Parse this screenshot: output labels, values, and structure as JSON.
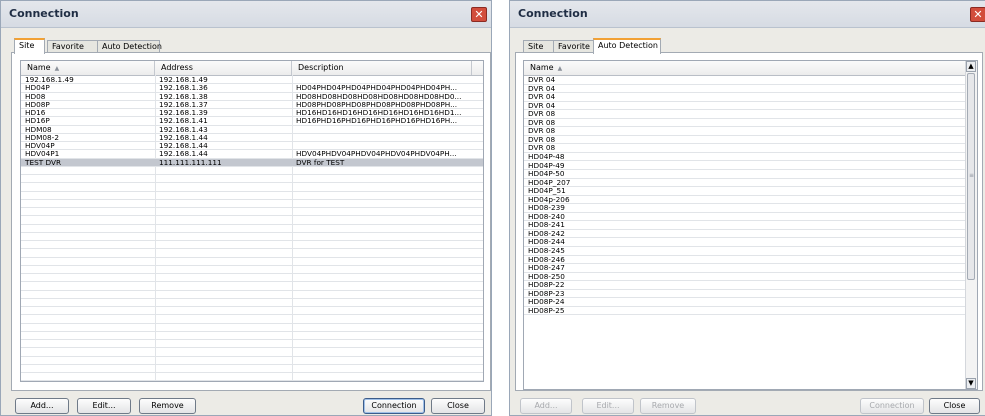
{
  "left": {
    "title": "Connection",
    "tabs": [
      {
        "label": "Site"
      },
      {
        "label": "Favorite"
      },
      {
        "label": "Auto Detection"
      }
    ],
    "columns": {
      "name": "Name",
      "address": "Address",
      "description": "Description"
    },
    "rows": [
      {
        "name": "192.168.1.49",
        "address": "192.168.1.49",
        "description": ""
      },
      {
        "name": "HD04P",
        "address": "192.168.1.36",
        "description": "HD04PHD04PHD04PHD04PHD04PHD04PH..."
      },
      {
        "name": "HD08",
        "address": "192.168.1.38",
        "description": "HD08HD08HD08HD08HD08HD08HD08HD0..."
      },
      {
        "name": "HD08P",
        "address": "192.168.1.37",
        "description": "HD08PHD08PHD08PHD08PHD08PHD08PH..."
      },
      {
        "name": "HD16",
        "address": "192.168.1.39",
        "description": "HD16HD16HD16HD16HD16HD16HD16HD1..."
      },
      {
        "name": "HD16P",
        "address": "192.168.1.41",
        "description": "HD16PHD16PHD16PHD16PHD16PHD16PH..."
      },
      {
        "name": "HDM08",
        "address": "192.168.1.43",
        "description": ""
      },
      {
        "name": "HDM08-2",
        "address": "192.168.1.44",
        "description": ""
      },
      {
        "name": "HDV04P",
        "address": "192.168.1.44",
        "description": ""
      },
      {
        "name": "HDV04P1",
        "address": "192.168.1.44",
        "description": "HDV04PHDV04PHDV04PHDV04PHDV04PH..."
      },
      {
        "name": "TEST DVR",
        "address": "111.111.111.111",
        "description": "DVR for TEST"
      }
    ],
    "buttons": {
      "add": "Add...",
      "edit": "Edit...",
      "remove": "Remove",
      "connection": "Connection",
      "close": "Close"
    }
  },
  "right": {
    "title": "Connection",
    "tabs": [
      {
        "label": "Site"
      },
      {
        "label": "Favorite"
      },
      {
        "label": "Auto Detection"
      }
    ],
    "columns": {
      "name": "Name"
    },
    "rows": [
      "DVR 04",
      "DVR 04",
      "DVR 04",
      "DVR 04",
      "DVR 08",
      "DVR 08",
      "DVR 08",
      "DVR 08",
      "DVR 08",
      "HD04P-48",
      "HD04P-49",
      "HD04P-50",
      "HD04P_207",
      "HD04P_51",
      "HD04p-206",
      "HD08-239",
      "HD08-240",
      "HD08-241",
      "HD08-242",
      "HD08-244",
      "HD08-245",
      "HD08-246",
      "HD08-247",
      "HD08-250",
      "HD08P-22",
      "HD08P-23",
      "HD08P-24",
      "HD08P-25"
    ],
    "buttons": {
      "add": "Add...",
      "edit": "Edit...",
      "remove": "Remove",
      "connection": "Connection",
      "close": "Close"
    }
  },
  "selected_row": 10,
  "colors": {
    "tab_accent": "#f2a134",
    "selection": "#c3c7cf",
    "close_button": "#d24d3c"
  }
}
